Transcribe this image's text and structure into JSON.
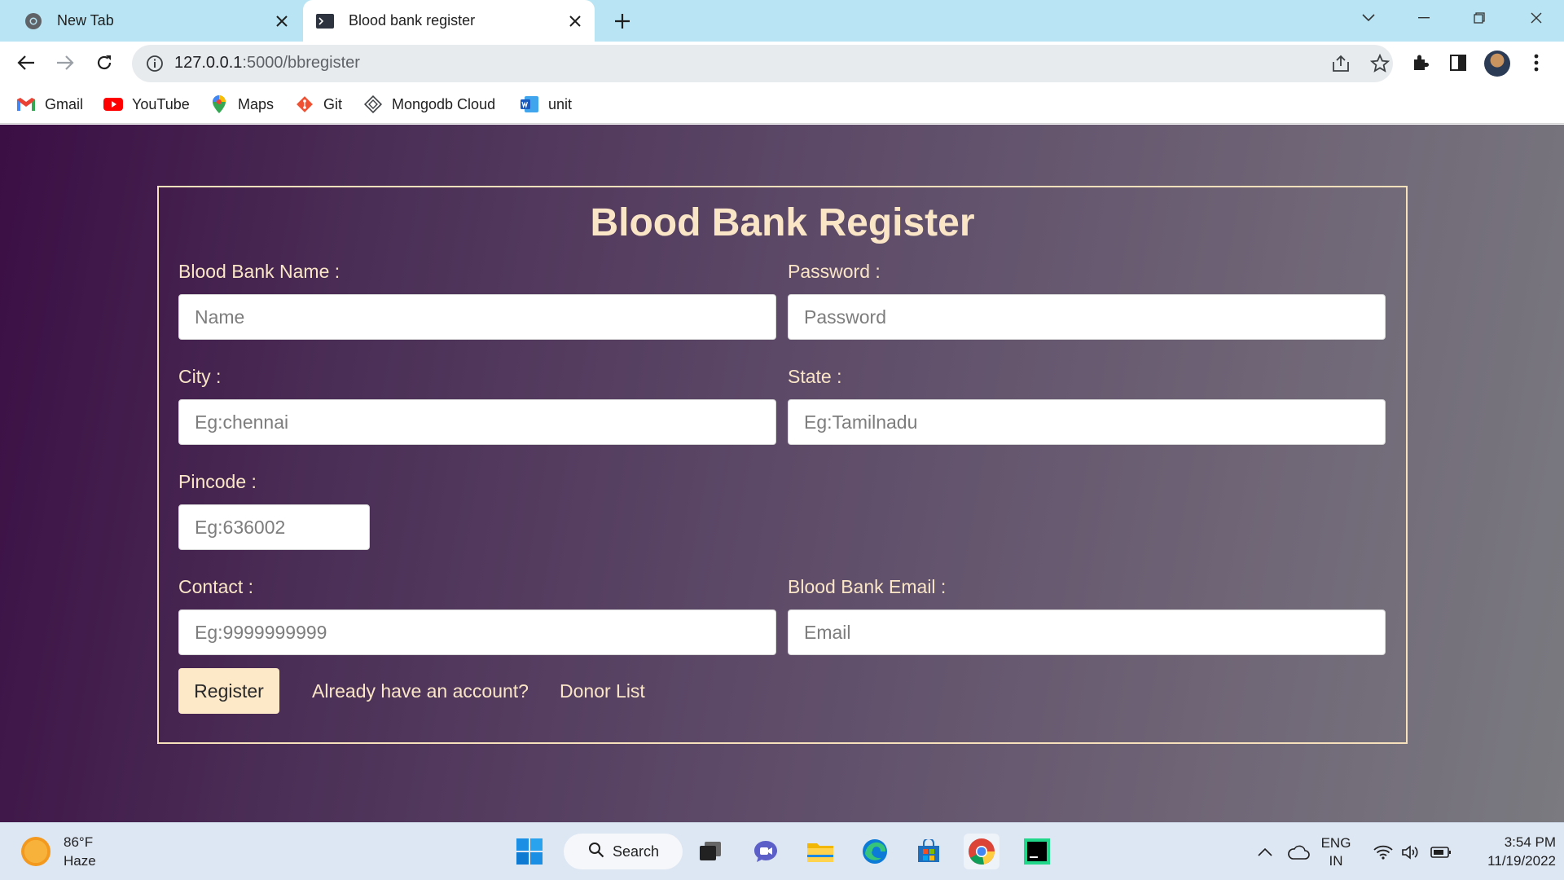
{
  "browser": {
    "tabs": [
      {
        "title": "New Tab",
        "active": false
      },
      {
        "title": "Blood bank register",
        "active": true
      }
    ],
    "address": {
      "host": "127.0.0.1",
      "path": ":5000/bbregister"
    },
    "bookmarks": [
      {
        "label": "Gmail",
        "icon": "gmail-icon"
      },
      {
        "label": "YouTube",
        "icon": "youtube-icon"
      },
      {
        "label": "Maps",
        "icon": "maps-icon"
      },
      {
        "label": "Git",
        "icon": "git-icon"
      },
      {
        "label": "Mongodb Cloud",
        "icon": "mongodb-icon"
      },
      {
        "label": "unit",
        "icon": "word-icon"
      }
    ]
  },
  "form": {
    "title": "Blood Bank Register",
    "fields": {
      "name": {
        "label": "Blood Bank Name :",
        "placeholder": "Name"
      },
      "password": {
        "label": "Password :",
        "placeholder": "Password"
      },
      "city": {
        "label": "City :",
        "placeholder": "Eg:chennai"
      },
      "state": {
        "label": "State :",
        "placeholder": "Eg:Tamilnadu"
      },
      "pincode": {
        "label": "Pincode :",
        "placeholder": "Eg:636002"
      },
      "contact": {
        "label": "Contact :",
        "placeholder": "Eg:9999999999"
      },
      "email": {
        "label": "Blood Bank Email :",
        "placeholder": "Email"
      }
    },
    "register_label": "Register",
    "login_link": "Already have an account?",
    "donor_link": "Donor List"
  },
  "taskbar": {
    "weather": {
      "temp": "86°F",
      "condition": "Haze"
    },
    "search_label": "Search",
    "language": {
      "line1": "ENG",
      "line2": "IN"
    },
    "clock": {
      "time": "3:54 PM",
      "date": "11/19/2022"
    }
  },
  "colors": {
    "accent_text": "#fae6c6",
    "tabstrip": "#b8e4f3",
    "page_gradient_start": "#3b0e44",
    "page_gradient_end": "#7a7a80"
  }
}
